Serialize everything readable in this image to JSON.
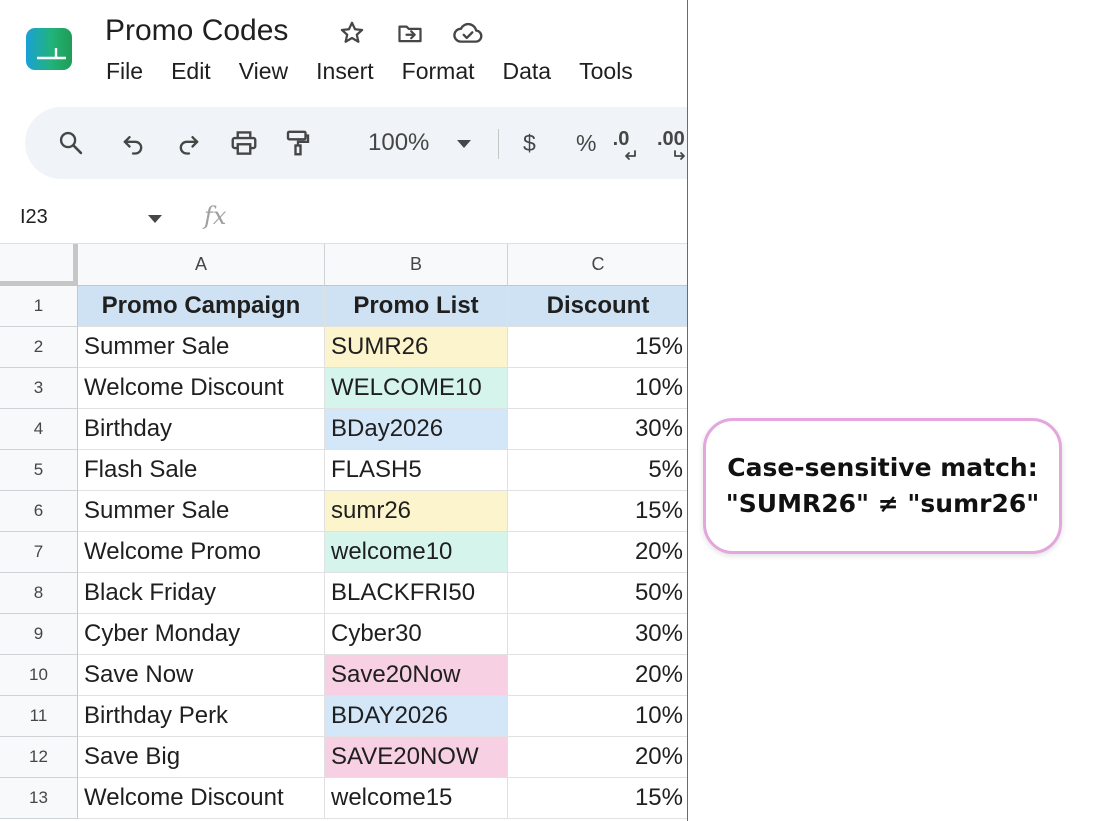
{
  "app": {
    "title": "Promo Codes",
    "menu": [
      "File",
      "Edit",
      "View",
      "Insert",
      "Format",
      "Data",
      "Tools"
    ]
  },
  "toolbar": {
    "zoom": "100%",
    "currency_label": "$",
    "percent_label": "%",
    "decrease_decimal_label": ".0",
    "increase_decimal_label": ".00"
  },
  "formula_bar": {
    "cell_ref": "I23",
    "fx_label": "fx"
  },
  "sheet": {
    "columns": [
      "A",
      "B",
      "C"
    ],
    "rows": [
      "1",
      "2",
      "3",
      "4",
      "5",
      "6",
      "7",
      "8",
      "9",
      "10",
      "11",
      "12",
      "13"
    ],
    "header": [
      "Promo Campaign",
      "Promo List",
      "Discount"
    ],
    "header_fill": "#cfe2f3",
    "data": [
      {
        "campaign": "Summer Sale",
        "code": "SUMR26",
        "discount": "15%",
        "fill": "#fcf4cc"
      },
      {
        "campaign": "Welcome Discount",
        "code": "WELCOME10",
        "discount": "10%",
        "fill": "#d5f5ec"
      },
      {
        "campaign": "Birthday",
        "code": "BDay2026",
        "discount": "30%",
        "fill": "#d3e7f8"
      },
      {
        "campaign": "Flash Sale",
        "code": "FLASH5",
        "discount": "5%",
        "fill": ""
      },
      {
        "campaign": "Summer Sale",
        "code": "sumr26",
        "discount": "15%",
        "fill": "#fcf4cc"
      },
      {
        "campaign": "Welcome Promo",
        "code": "welcome10",
        "discount": "20%",
        "fill": "#d5f5ec"
      },
      {
        "campaign": "Black Friday",
        "code": "BLACKFRI50",
        "discount": "50%",
        "fill": ""
      },
      {
        "campaign": "Cyber Monday",
        "code": "Cyber30",
        "discount": "30%",
        "fill": ""
      },
      {
        "campaign": "Save Now",
        "code": "Save20Now",
        "discount": "20%",
        "fill": "#f8d0e4"
      },
      {
        "campaign": "Birthday Perk",
        "code": "BDAY2026",
        "discount": "10%",
        "fill": "#d3e7f8"
      },
      {
        "campaign": "Save Big",
        "code": "SAVE20NOW",
        "discount": "20%",
        "fill": "#f8d0e4"
      },
      {
        "campaign": "Welcome Discount",
        "code": "welcome15",
        "discount": "15%",
        "fill": ""
      }
    ]
  },
  "callout": {
    "line1": "Case-sensitive match:",
    "line2": "\"SUMR26\" ≠ \"sumr26\"",
    "border_color": "#e3a6dd"
  }
}
